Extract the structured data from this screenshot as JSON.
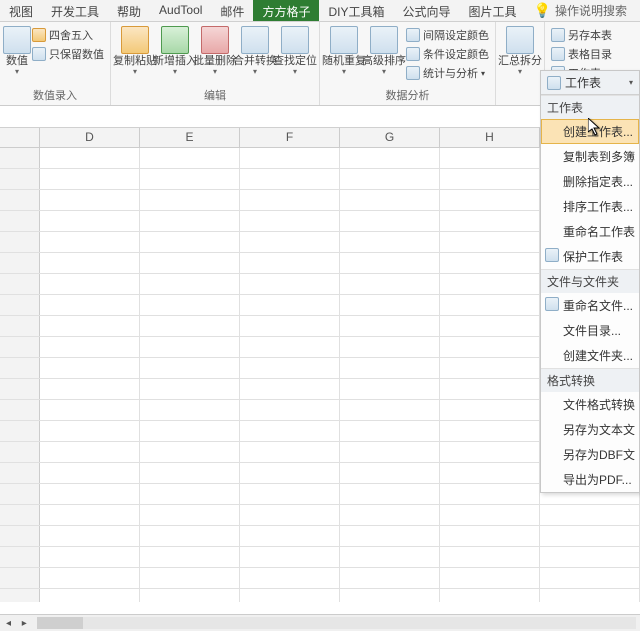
{
  "tabs": {
    "t0": "视图",
    "t1": "开发工具",
    "t2": "帮助",
    "t3": "AudTool",
    "t4": "邮件",
    "t5": "方方格子",
    "t6": "DIY工具箱",
    "t7": "公式向导",
    "t8": "图片工具",
    "tell_me": "操作说明搜索"
  },
  "ribbon": {
    "num_entry": {
      "round": "四舍五入",
      "keep_value": "只保留数值",
      "num_drop": "数值",
      "label": "数值录入"
    },
    "edit": {
      "paste": "复制粘贴",
      "insert": "新增插入",
      "batch_del": "批量删除",
      "merge_convert": "合并转换",
      "find_locate": "查找定位",
      "label": "编辑"
    },
    "analysis": {
      "random": "随机重复",
      "sort": "高级排序",
      "interval_color": "间隔设定颜色",
      "cond_color": "条件设定颜色",
      "stats_analysis": "统计与分析",
      "label": "数据分析"
    },
    "summary": {
      "split": "汇总拆分"
    },
    "sheet_tools": {
      "save_as_table": "另存本表",
      "table_catalog": "表格目录",
      "worksheet_btn": "工作表"
    }
  },
  "columns": {
    "c1": "D",
    "c2": "E",
    "c3": "F",
    "c4": "G",
    "c5": "H"
  },
  "menu": {
    "root": "工作表",
    "sec1": "工作表",
    "i1": "创建工作表...",
    "i2": "复制表到多簿",
    "i3": "删除指定表...",
    "i4": "排序工作表...",
    "i5": "重命名工作表",
    "i6": "保护工作表",
    "sec2": "文件与文件夹",
    "i7": "重命名文件...",
    "i8": "文件目录...",
    "i9": "创建文件夹...",
    "sec3": "格式转换",
    "i10": "文件格式转换",
    "i11": "另存为文本文",
    "i12": "另存为DBF文",
    "i13": "导出为PDF..."
  }
}
